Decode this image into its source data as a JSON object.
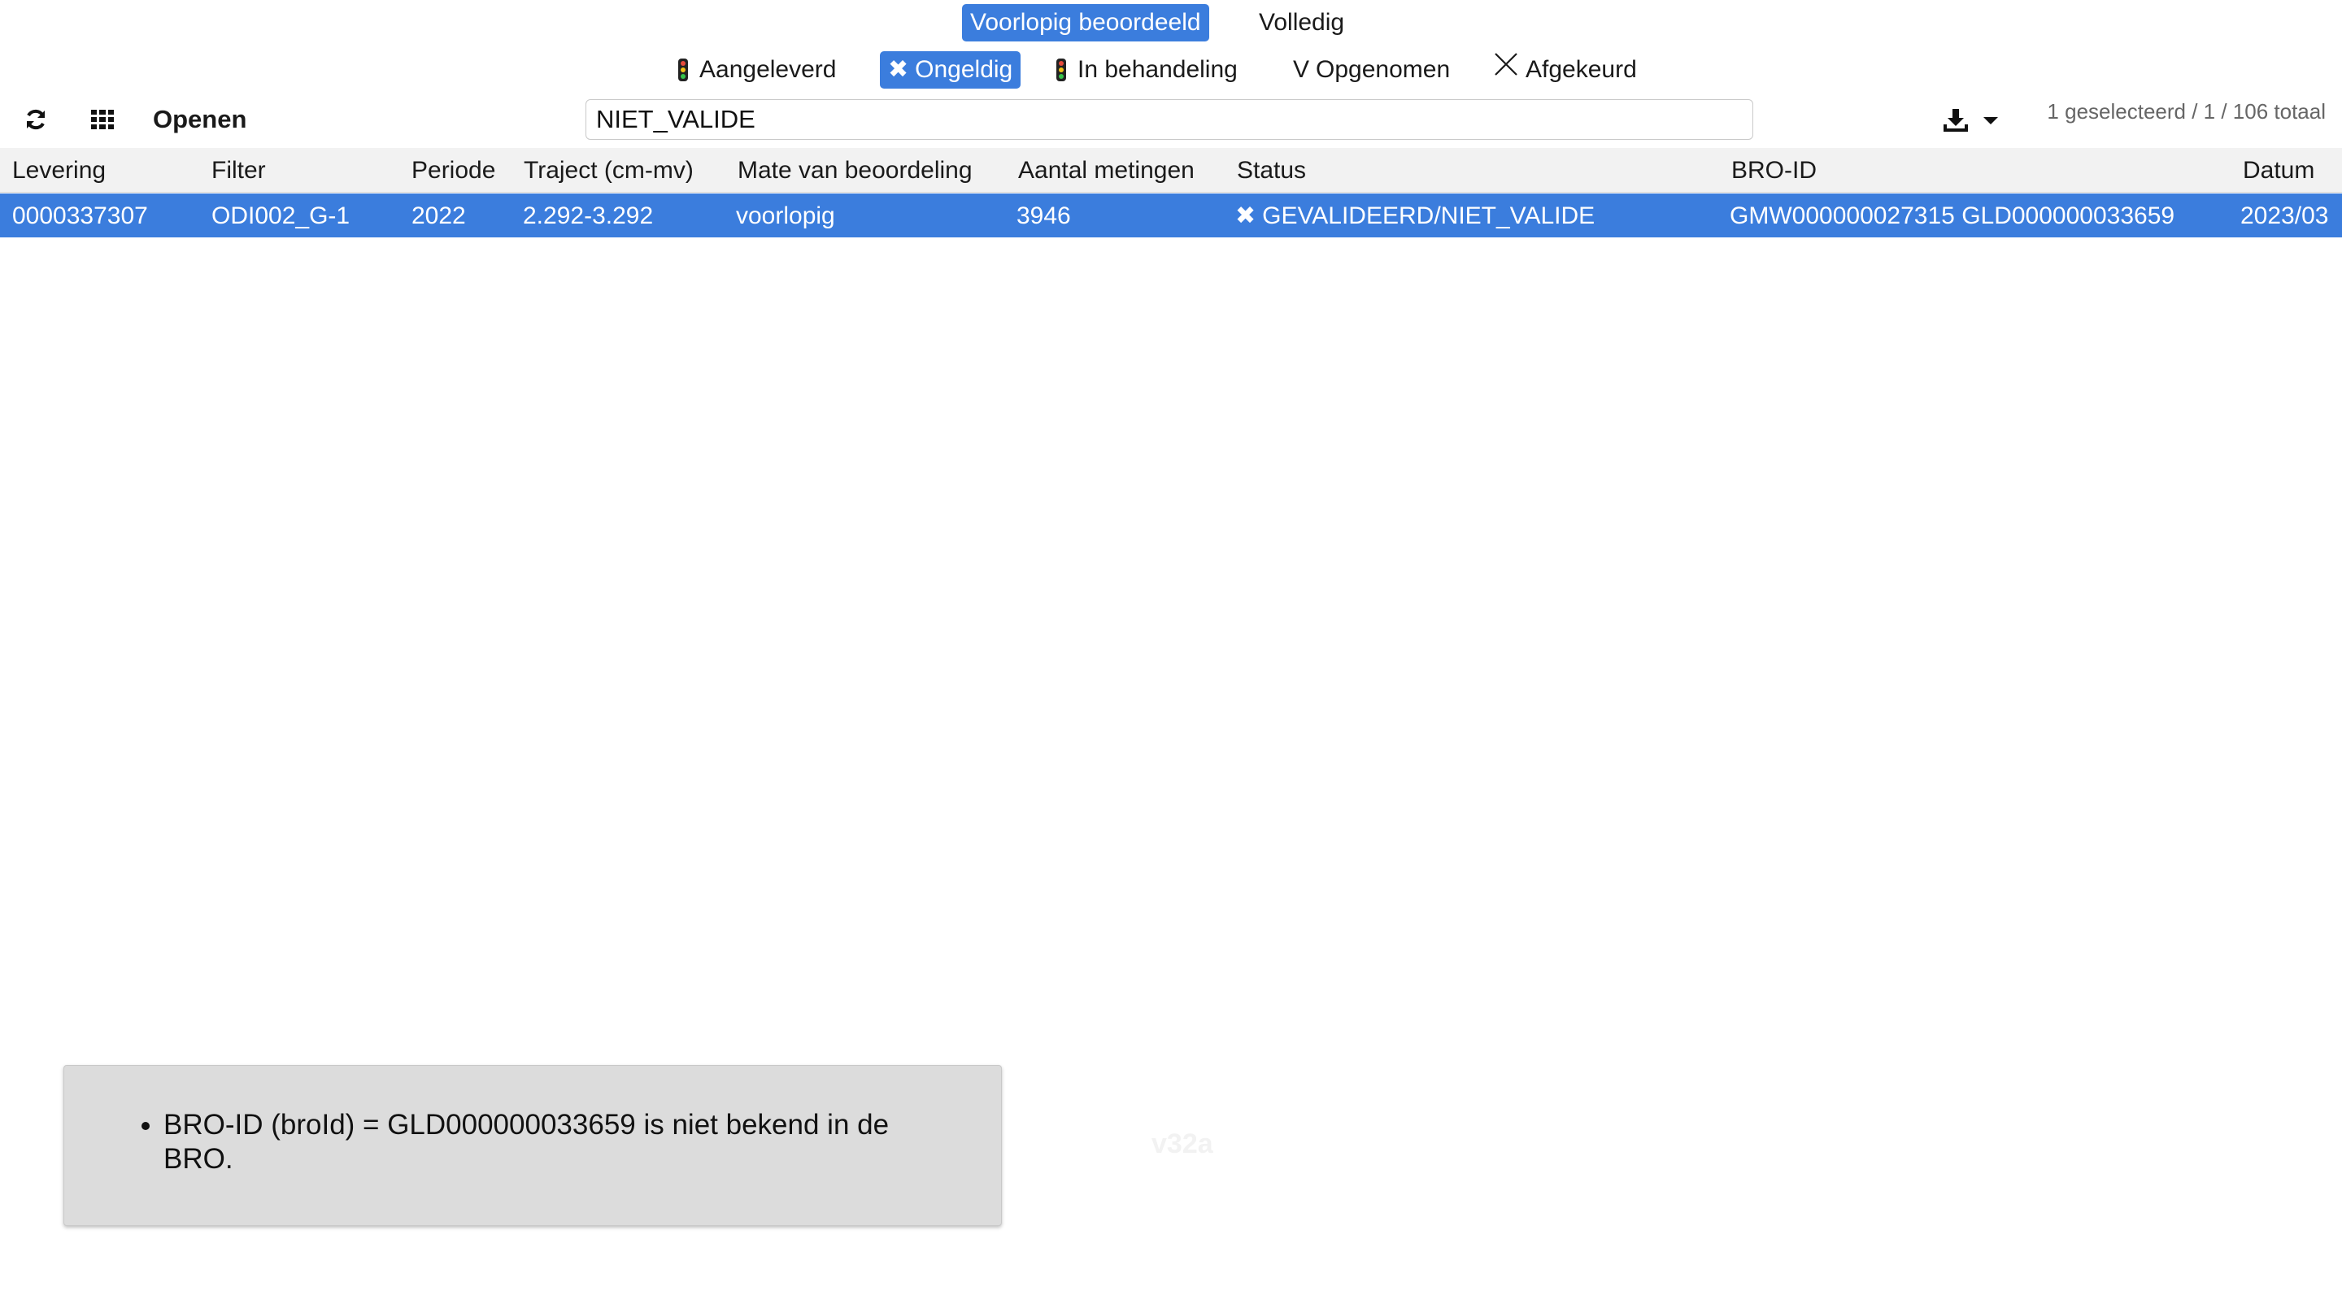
{
  "mate": {
    "options": [
      "Voorlopig beoordeeld",
      "Volledig"
    ],
    "selected": "Voorlopig beoordeeld"
  },
  "status_filters": [
    {
      "label": "Aangeleverd",
      "icon": "traffic-light-icon",
      "active": false
    },
    {
      "label": "Ongeldig",
      "icon": "x-mark-icon",
      "active": true
    },
    {
      "label": "In behandeling",
      "icon": "traffic-light-icon",
      "active": false
    },
    {
      "label": "Opgenomen",
      "icon_text": "V",
      "active": false
    },
    {
      "label": "Afgekeurd",
      "icon": "cross-icon",
      "active": false
    }
  ],
  "toolbar": {
    "refresh_icon": "refresh-icon",
    "grid_icon": "grid-icon",
    "open_label": "Openen",
    "search_value": "NIET_VALIDE",
    "download_icon": "download-icon",
    "count_text": "1 geselecteerd / 1 / 106 totaal"
  },
  "table": {
    "columns": [
      "Levering",
      "Filter",
      "Periode",
      "Traject (cm-mv)",
      "Mate van beoordeling",
      "Aantal metingen",
      "Status",
      "BRO-ID",
      "Datum"
    ],
    "rows": [
      {
        "levering": "0000337307",
        "filter": "ODI002_G-1",
        "periode": "2022",
        "traject": "2.292-3.292",
        "mate": "voorlopig",
        "aantal": "3946",
        "status": "GEVALIDEERD/NIET_VALIDE",
        "bro_id": "GMW000000027315 GLD000000033659",
        "datum": "2023/03"
      }
    ]
  },
  "message": {
    "items": [
      "BRO-ID (broId) = GLD000000033659 is niet bekend in de BRO."
    ]
  },
  "version": "v32a",
  "colors": {
    "accent": "#3b7ddd",
    "header_bg": "#f2f2f2",
    "message_bg": "#dcdcdc"
  }
}
